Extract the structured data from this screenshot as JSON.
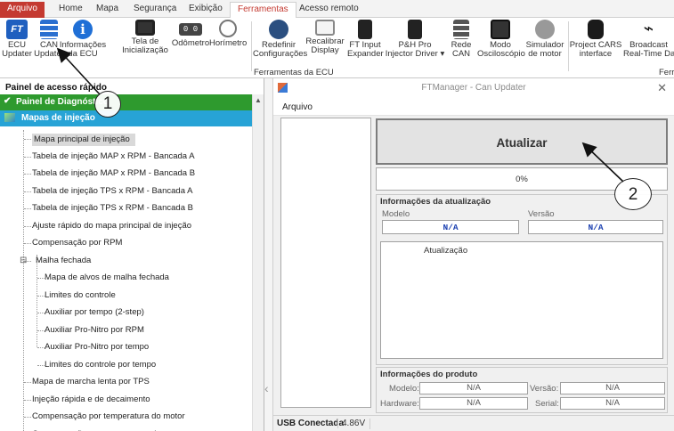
{
  "menu": {
    "tabs": [
      "Arquivo",
      "Home",
      "Mapa",
      "Segurança",
      "Exibição",
      "Ferramentas",
      "Acesso remoto"
    ],
    "selected_index": 5
  },
  "ribbon": {
    "buttons": [
      {
        "label": "ECU\nUpdater",
        "icon": "ft-logo-icon",
        "color": "#1f5fbf"
      },
      {
        "label": "CAN\nUpdater",
        "icon": "can-stack-icon",
        "color": "#2a6fd0"
      },
      {
        "label": "Informações\nda ECU",
        "icon": "info-icon",
        "color": "#1f6fd6"
      },
      {
        "label": "Tela de\nInicialização",
        "icon": "splash-screen-icon",
        "color": "#333333"
      },
      {
        "label": "Odômetro",
        "icon": "odometer-icon",
        "color": "#444444"
      },
      {
        "label": "Horímetro",
        "icon": "stopwatch-icon",
        "color": "#7a7a7a"
      },
      {
        "label": "Redefinir\nConfigurações",
        "icon": "gears-reset-icon",
        "color": "#2b4f80"
      },
      {
        "label": "Recalibrar\nDisplay",
        "icon": "display-calibrate-icon",
        "color": "#777777"
      },
      {
        "label": "FT Input\nExpander",
        "icon": "input-expander-icon",
        "color": "#222222"
      },
      {
        "label": "P&H Pro\nInjector Driver ▾",
        "icon": "injector-driver-icon",
        "color": "#222222"
      },
      {
        "label": "Rede\nCAN",
        "icon": "can-network-icon",
        "color": "#555555"
      },
      {
        "label": "Modo\nOsciloscópio",
        "icon": "oscilloscope-icon",
        "color": "#333333"
      },
      {
        "label": "Simulador\nde motor",
        "icon": "engine-simulator-icon",
        "color": "#888888"
      },
      {
        "label": "Project CARS\ninterface",
        "icon": "project-cars-icon",
        "color": "#1a1a1a"
      },
      {
        "label": "Broadcast\nReal-Time Data",
        "icon": "broadcast-icon",
        "color": "#1a1a1a"
      }
    ],
    "group_label": "Ferramentas da ECU",
    "group_label_right": "Ferr"
  },
  "left_panel": {
    "title": "Painel de acesso rápido",
    "sections": [
      {
        "label": "Painel de Diagnóstico",
        "color": "#2e9a2e"
      },
      {
        "label": "Mapas de injeção",
        "color": "#27a3d6"
      }
    ],
    "items": [
      {
        "label": "Mapa principal de injeção",
        "selected": true
      },
      {
        "label": "Tabela de injeção MAP x RPM - Bancada A"
      },
      {
        "label": "Tabela de injeção MAP x RPM - Bancada B"
      },
      {
        "label": "Tabela de injeção TPS x RPM - Bancada A"
      },
      {
        "label": "Tabela de injeção TPS x RPM - Bancada B"
      },
      {
        "label": "Ajuste rápido do mapa principal de injeção"
      },
      {
        "label": "Compensação por RPM"
      },
      {
        "label": "Malha fechada",
        "expander": "⊟"
      },
      {
        "label": "Mapa de alvos de malha fechada",
        "child": true
      },
      {
        "label": "Limites do controle",
        "child": true
      },
      {
        "label": "Auxiliar por tempo (2-step)",
        "child": true
      },
      {
        "label": "Auxiliar Pro-Nitro por RPM",
        "child": true
      },
      {
        "label": "Auxiliar Pro-Nitro por tempo",
        "child": true
      },
      {
        "label": "Limites do controle por tempo",
        "child": true
      },
      {
        "label": "Mapa de marcha lenta por TPS"
      },
      {
        "label": "Injeção rápida e de decaimento"
      },
      {
        "label": "Compensação por temperatura do motor"
      },
      {
        "label": "Compensação por temperatura do ar"
      }
    ]
  },
  "window": {
    "title": "FTManager - Can Updater",
    "menu_item": "Arquivo",
    "update_button": "Atualizar",
    "progress_percent": 0,
    "progress_text": "0%",
    "update_info": {
      "title": "Informações da atualização",
      "model_label": "Modelo",
      "model_value": "N/A",
      "version_label": "Versão",
      "version_value": "N/A",
      "log_label": "Atualização"
    },
    "product_info": {
      "title": "Informações do produto",
      "model_label": "Modelo:",
      "model_value": "N/A",
      "version_label": "Versão:",
      "version_value": "N/A",
      "hardware_label": "Hardware:",
      "hardware_value": "N/A",
      "serial_label": "Serial:",
      "serial_value": "N/A"
    },
    "status": {
      "connection": "USB Conectada",
      "voltage": "4.86V"
    }
  },
  "callouts": [
    "1",
    "2"
  ]
}
